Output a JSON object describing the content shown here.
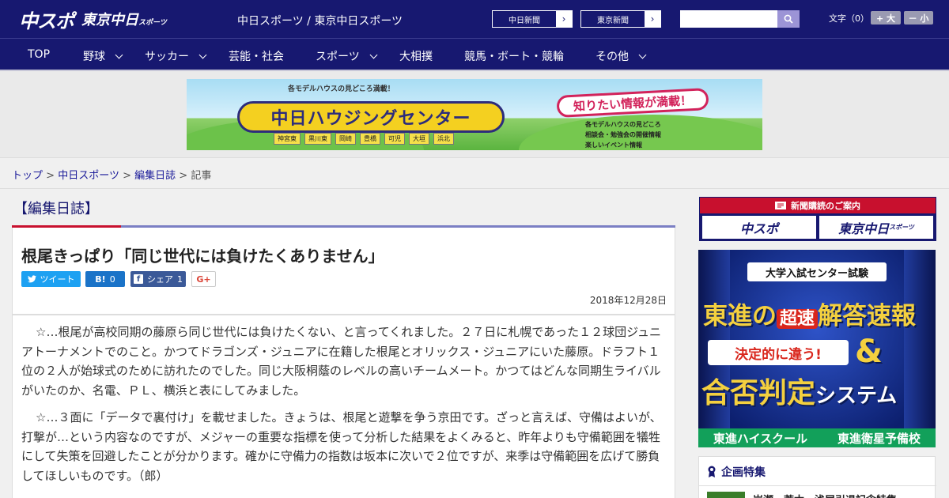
{
  "header": {
    "logo_chunichi_sports": "中スポ",
    "logo_tokyo_chunichi": "東京中日",
    "logo_sports_small": "スポーツ",
    "site_title": "中日スポーツ / 東京中日スポーツ",
    "links": [
      {
        "label": "中日新聞"
      },
      {
        "label": "東京新聞"
      }
    ],
    "search_value": "",
    "font_size_label": "文字（0）",
    "font_bigger": "+ 大",
    "font_smaller": "－ 小"
  },
  "nav": {
    "items": [
      {
        "label": "TOP"
      },
      {
        "label": "野球"
      },
      {
        "label": "サッカー"
      },
      {
        "label": "芸能・社会"
      },
      {
        "label": "スポーツ"
      },
      {
        "label": "大相撲"
      },
      {
        "label": "競馬・ボート・競輪"
      },
      {
        "label": "その他"
      }
    ]
  },
  "banner": {
    "tagline": "各モデルハウスの見どころ満載！",
    "title": "中日ハウジングセンター",
    "callout": "知りたい情報が満載！",
    "locations": [
      "神宮東",
      "黒川東",
      "岡崎",
      "豊橋",
      "可児",
      "大垣",
      "浜北"
    ],
    "features": [
      "各モデルハウスの見どころ",
      "相談会・勉強会の開催情報",
      "楽しいイベント情報"
    ]
  },
  "breadcrumb": {
    "items": [
      {
        "label": "トップ"
      },
      {
        "label": "中日スポーツ"
      },
      {
        "label": "編集日誌"
      }
    ],
    "current": "記事",
    "separator": ">"
  },
  "section": {
    "title": "【編集日誌】"
  },
  "article": {
    "title": "根尾きっぱり「同じ世代には負けたくありません」",
    "share": {
      "tweet": "ツイート",
      "hatena_label": "B!",
      "hatena_count": "0",
      "facebook_label": "シェア",
      "facebook_count": "1",
      "gplus": "G+"
    },
    "date": "2018年12月28日",
    "paragraphs": [
      "☆…根尾が高校同期の藤原ら同じ世代には負けたくない、と言ってくれました。２７日に札幌であった１２球団ジュニアトーナメントでのこと。かつてドラゴンズ・ジュニアに在籍した根尾とオリックス・ジュニアにいた藤原。ドラフト１位の２人が始球式のために訪れたのでした。同じ大阪桐蔭のレベルの高いチームメート。かつてはどんな同期生ライバルがいたのか、名電、ＰＬ、横浜と表にしてみました。",
      "☆…３面に「データで裏付け」を載せました。きょうは、根尾と遊撃を争う京田です。ざっと言えば、守備はよいが、打撃が…という内容なのですが、メジャーの重要な指標を使って分析した結果をよくみると、昨年よりも守備範囲を犠牲にして失策を回避したことが分かります。確かに守備力の指数は坂本に次いで２位ですが、来季は守備範囲を広げて勝負してほしいものです。（郎）"
    ]
  },
  "sidebar": {
    "subscription_head": "新聞購読のご案内",
    "sub_logo_1": "中スポ",
    "sub_logo_2": "東京中日",
    "sub_logo_2_small": "スポーツ",
    "ad": {
      "line1": "大学入試センター試験",
      "line2_a": "東進の",
      "line2_b": "超速",
      "line2_c": "解答速報",
      "line3": "決定的に違う!",
      "amp": "&",
      "line4_a": "合否判定",
      "line4_b": "システム",
      "footer_1": "東進ハイスクール",
      "footer_2": "東進衛星予備校"
    },
    "feature_head": "企画特集",
    "feature_item": "岩瀬・荒木・浅尾引退記念特集"
  },
  "colors": {
    "brand_navy": "#171870",
    "accent_red": "#c8102e",
    "accent_purple": "#7b7fc4",
    "link_blue": "#1a1a99"
  }
}
